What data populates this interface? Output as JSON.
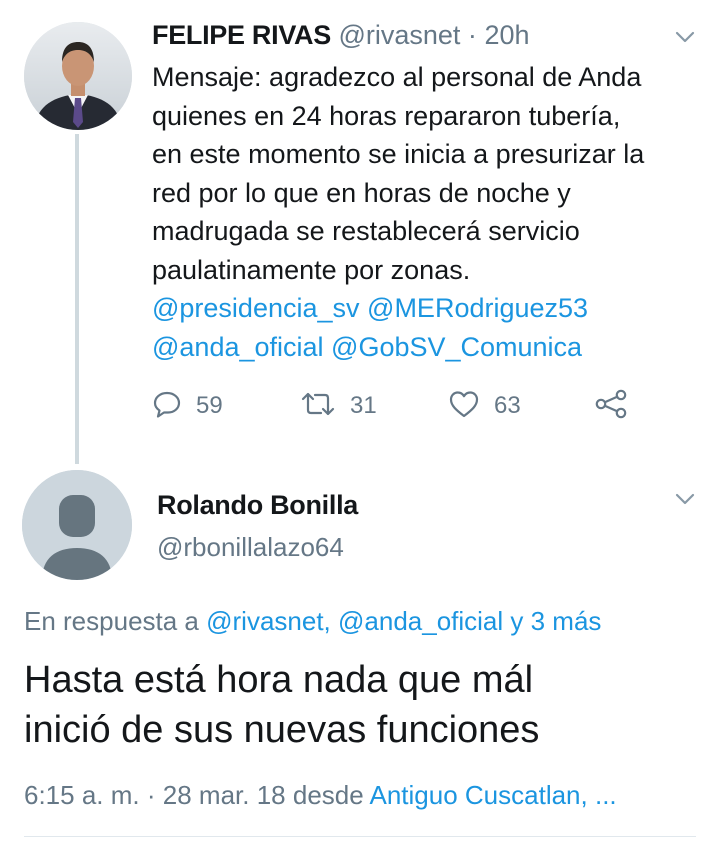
{
  "tweet": {
    "author_name": "FELIPE RIVAS",
    "author_handle": "@rivasnet",
    "separator": "·",
    "time": "20h",
    "body_lines": [
      "Mensaje: agradezco al personal de Anda",
      "quienes en 24 horas repararon tubería,",
      "en este momento se inicia a presurizar la",
      "red por lo que en horas de noche y",
      "madrugada se restablecerá servicio",
      "paulatinamente por zonas."
    ],
    "mentions_line1": [
      "@presidencia_sv",
      "@MERodriguez53"
    ],
    "mentions_line2": [
      "@anda_oficial",
      "@GobSV_Comunica"
    ],
    "reply_count": "59",
    "retweet_count": "31",
    "like_count": "63"
  },
  "reply": {
    "author_name": "Rolando Bonilla",
    "author_handle": "@rbonillalazo64",
    "in_reply_prefix": "En respuesta a",
    "in_reply_targets": "@rivasnet, @anda_oficial y 3 más",
    "body_lines": [
      "Hasta está hora nada que mál",
      "inició de sus nuevas funciones"
    ],
    "time": "6:15 a. m.",
    "date_separator": "·",
    "date": "28 mar. 18",
    "source_prefix": "desde",
    "location": "Antiguo Cuscatlan, ..."
  },
  "icons": {
    "reply": "comment-icon",
    "retweet": "retweet-icon",
    "like": "heart-icon",
    "share": "share-icon",
    "menu": "chevron-down-icon"
  },
  "colors": {
    "text": "#14171a",
    "secondary": "#657786",
    "link": "#1b95e0",
    "thread_line": "#cfd9de"
  }
}
